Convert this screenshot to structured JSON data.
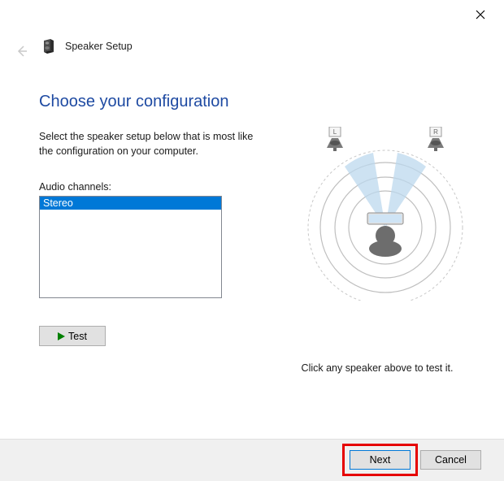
{
  "window": {
    "title": "Speaker Setup"
  },
  "heading": "Choose your configuration",
  "instruction": "Select the speaker setup below that is most like the configuration on your computer.",
  "channels_label": "Audio channels:",
  "channels_list": {
    "selected": "Stereo"
  },
  "test_button_label": "Test",
  "speaker_labels": {
    "left": "L",
    "right": "R"
  },
  "hint_text": "Click any speaker above to test it.",
  "footer": {
    "next": "Next",
    "cancel": "Cancel"
  }
}
